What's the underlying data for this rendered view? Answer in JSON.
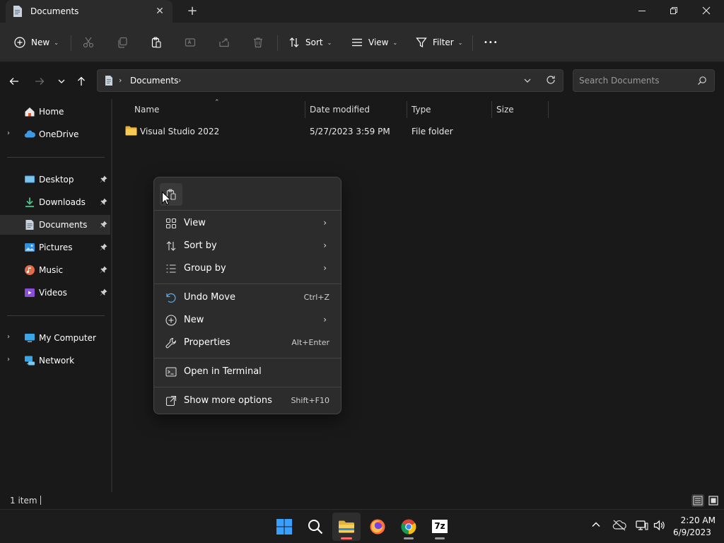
{
  "window": {
    "tab_title": "Documents",
    "tab_close": "✕",
    "new_tab": "+"
  },
  "commands": {
    "new_label": "New",
    "sort_label": "Sort",
    "view_label": "View",
    "filter_label": "Filter",
    "more": "•••"
  },
  "address": {
    "breadcrumb": "Documents",
    "search_placeholder": "Search Documents"
  },
  "sidebar": {
    "items": [
      {
        "label": "Home",
        "icon": "home-icon"
      },
      {
        "label": "OneDrive",
        "icon": "cloud-icon"
      },
      {
        "label": "Desktop",
        "icon": "desktop-icon"
      },
      {
        "label": "Downloads",
        "icon": "download-icon"
      },
      {
        "label": "Documents",
        "icon": "document-icon"
      },
      {
        "label": "Pictures",
        "icon": "pictures-icon"
      },
      {
        "label": "Music",
        "icon": "music-icon"
      },
      {
        "label": "Videos",
        "icon": "videos-icon"
      },
      {
        "label": "My Computer",
        "icon": "computer-icon"
      },
      {
        "label": "Network",
        "icon": "network-icon"
      }
    ]
  },
  "columns": {
    "name": "Name",
    "date": "Date modified",
    "type": "Type",
    "size": "Size"
  },
  "files": [
    {
      "name": "Visual Studio 2022",
      "date": "5/27/2023 3:59 PM",
      "type": "File folder",
      "size": ""
    }
  ],
  "context_menu": {
    "items": [
      {
        "label": "View",
        "shortcut": ""
      },
      {
        "label": "Sort by",
        "shortcut": ""
      },
      {
        "label": "Group by",
        "shortcut": ""
      },
      {
        "label": "Undo Move",
        "shortcut": "Ctrl+Z"
      },
      {
        "label": "New",
        "shortcut": ""
      },
      {
        "label": "Properties",
        "shortcut": "Alt+Enter"
      },
      {
        "label": "Open in Terminal",
        "shortcut": ""
      },
      {
        "label": "Show more options",
        "shortcut": "Shift+F10"
      }
    ]
  },
  "status": {
    "item_count": "1 item"
  },
  "clock": {
    "time": "2:20 AM",
    "date": "6/9/2023"
  },
  "taskbar": {
    "seven_zip_label": "7z"
  },
  "colors": {
    "accent": "#0078d4",
    "folder": "#f0c24b",
    "menu_bg": "#2c2c2c",
    "window_bg": "#191919"
  }
}
